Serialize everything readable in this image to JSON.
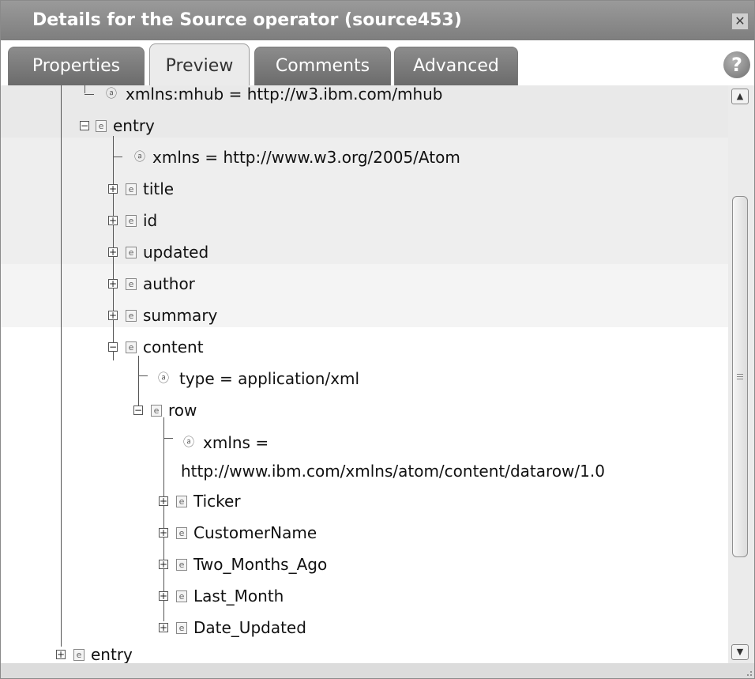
{
  "dialog": {
    "title": "Details for the Source operator (source453)",
    "close_icon": "close-icon",
    "help_icon": "help-icon"
  },
  "tabs": [
    {
      "label": "Properties",
      "active": false
    },
    {
      "label": "Preview",
      "active": true
    },
    {
      "label": "Comments",
      "active": false
    },
    {
      "label": "Advanced",
      "active": false
    }
  ],
  "tree": {
    "nodes": [
      {
        "type": "attribute",
        "text": "xmlns:mhub = http://w3.ibm.com/mhub"
      },
      {
        "type": "element",
        "text": "entry",
        "expanded": true
      },
      {
        "type": "attribute",
        "text": "xmlns = http://www.w3.org/2005/Atom"
      },
      {
        "type": "element",
        "text": "title",
        "expanded": false
      },
      {
        "type": "element",
        "text": "id",
        "expanded": false
      },
      {
        "type": "element",
        "text": "updated",
        "expanded": false
      },
      {
        "type": "element",
        "text": "author",
        "expanded": false
      },
      {
        "type": "element",
        "text": "summary",
        "expanded": false
      },
      {
        "type": "element",
        "text": "content",
        "expanded": true
      },
      {
        "type": "attribute",
        "text": "type = application/xml"
      },
      {
        "type": "element",
        "text": "row",
        "expanded": true
      },
      {
        "type": "attribute",
        "text": "xmlns =",
        "continuation": "http://www.ibm.com/xmlns/atom/content/datarow/1.0"
      },
      {
        "type": "element",
        "text": "Ticker",
        "expanded": false
      },
      {
        "type": "element",
        "text": "CustomerName",
        "expanded": false
      },
      {
        "type": "element",
        "text": "Two_Months_Ago",
        "expanded": false
      },
      {
        "type": "element",
        "text": "Last_Month",
        "expanded": false
      },
      {
        "type": "element",
        "text": "Date_Updated",
        "expanded": false
      },
      {
        "type": "element",
        "text": "entry",
        "expanded": false
      }
    ],
    "element_glyph": "e",
    "attribute_glyph": "ⓐ",
    "expand_glyph": "+",
    "collapse_glyph": "−"
  },
  "scrollbar": {
    "up_icon": "scroll-up-icon",
    "down_icon": "scroll-down-icon"
  }
}
